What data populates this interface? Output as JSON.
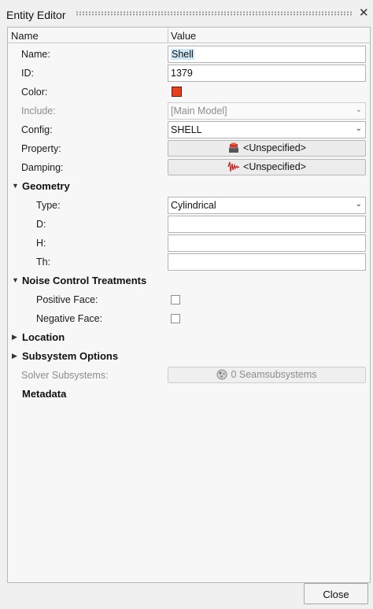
{
  "window": {
    "title": "Entity Editor",
    "close_glyph": "✕"
  },
  "columns": {
    "name": "Name",
    "value": "Value"
  },
  "fields": {
    "name": {
      "label": "Name:",
      "value": "Shell"
    },
    "id": {
      "label": "ID:",
      "value": "1379"
    },
    "color": {
      "label": "Color:",
      "swatch": "#e8401c"
    },
    "include": {
      "label": "Include:",
      "value": "[Main Model]"
    },
    "config": {
      "label": "Config:",
      "value": "SHELL"
    },
    "property": {
      "label": "Property:",
      "value": "<Unspecified>",
      "icon": "property-icon"
    },
    "damping": {
      "label": "Damping:",
      "value": "<Unspecified>",
      "icon": "damping-icon"
    }
  },
  "sections": {
    "geometry": {
      "label": "Geometry",
      "type": {
        "label": "Type:",
        "value": "Cylindrical"
      },
      "d": {
        "label": "D:",
        "value": ""
      },
      "h": {
        "label": "H:",
        "value": ""
      },
      "th": {
        "label": "Th:",
        "value": ""
      }
    },
    "noise": {
      "label": "Noise Control Treatments",
      "positive": {
        "label": "Positive Face:",
        "checked": false
      },
      "negative": {
        "label": "Negative Face:",
        "checked": false
      }
    },
    "location": {
      "label": "Location"
    },
    "subsystem": {
      "label": "Subsystem Options",
      "solver": {
        "label": "Solver Subsystems:",
        "value": "0 Seamsubsystems",
        "icon": "subsystem-icon"
      }
    },
    "metadata": {
      "label": "Metadata"
    }
  },
  "footer": {
    "close_label": "Close"
  }
}
